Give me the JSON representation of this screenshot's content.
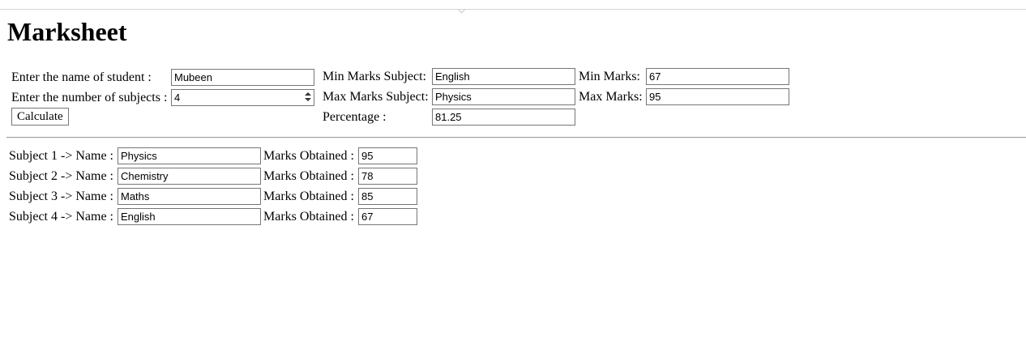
{
  "page": {
    "title": "Marksheet"
  },
  "form": {
    "student_name_label": "Enter the name of student :",
    "student_name_value": "Mubeen",
    "num_subjects_label": "Enter the number of subjects :",
    "num_subjects_value": "4",
    "calculate_label": "Calculate"
  },
  "results": {
    "min_subject_label": "Min Marks Subject:",
    "min_subject_value": "English",
    "min_marks_label": "Min Marks:",
    "min_marks_value": "67",
    "max_subject_label": "Max Marks Subject:",
    "max_subject_value": "Physics",
    "max_marks_label": "Max Marks:",
    "max_marks_value": "95",
    "percentage_label": "Percentage :",
    "percentage_value": "81.25"
  },
  "subjects": [
    {
      "label": "Subject 1 -> Name :",
      "name": "Physics",
      "marks_label": "Marks Obtained :",
      "marks": "95"
    },
    {
      "label": "Subject 2 -> Name :",
      "name": "Chemistry",
      "marks_label": "Marks Obtained :",
      "marks": "78"
    },
    {
      "label": "Subject 3 -> Name :",
      "name": "Maths",
      "marks_label": "Marks Obtained :",
      "marks": "85"
    },
    {
      "label": "Subject 4 -> Name :",
      "name": "English",
      "marks_label": "Marks Obtained :",
      "marks": "67"
    }
  ]
}
